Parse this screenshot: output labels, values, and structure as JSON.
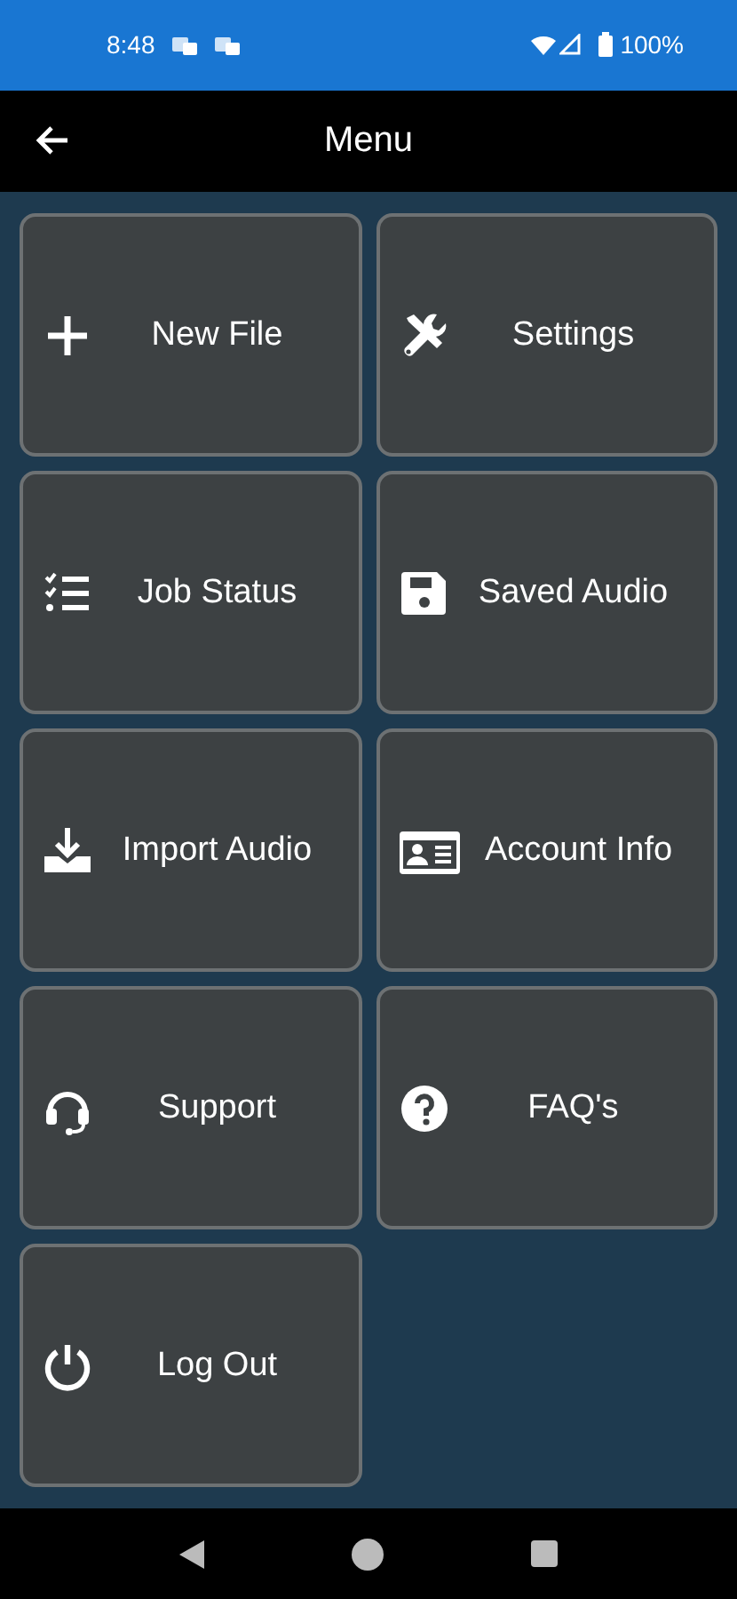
{
  "status_bar": {
    "time": "8:48",
    "battery": "100%"
  },
  "app_bar": {
    "title": "Menu"
  },
  "tiles": [
    {
      "label": "New File",
      "kind": "plus"
    },
    {
      "label": "Settings",
      "kind": "tools"
    },
    {
      "label": "Job Status",
      "kind": "checklist"
    },
    {
      "label": "Saved Audio",
      "kind": "floppy"
    },
    {
      "label": "Import Audio",
      "kind": "download"
    },
    {
      "label": "Account Info",
      "kind": "idcard"
    },
    {
      "label": "Support",
      "kind": "headset"
    },
    {
      "label": "FAQ's",
      "kind": "help"
    },
    {
      "label": "Log Out",
      "kind": "power"
    }
  ]
}
